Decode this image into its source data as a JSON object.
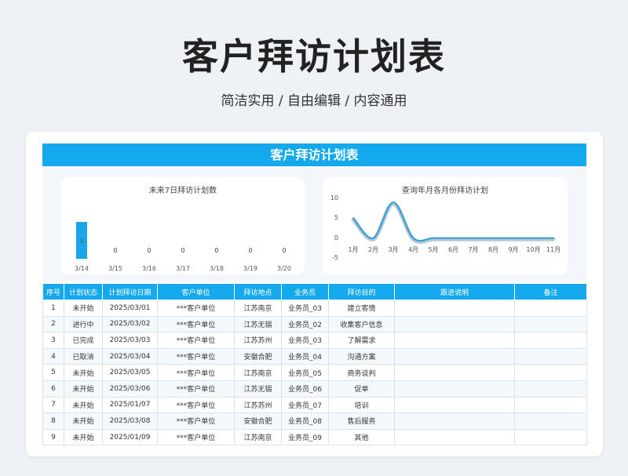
{
  "header": {
    "title": "客户拜访计划表",
    "subtitle": "简洁实用 / 自由编辑 / 内容通用"
  },
  "sheet": {
    "title": "客户拜访计划表"
  },
  "colors": {
    "accent": "#14a8ec",
    "line": "#2a9fd8",
    "shadow": "#b8c6d2"
  },
  "chart_data": [
    {
      "type": "bar",
      "title": "未来7日拜访计划数",
      "categories": [
        "3/14",
        "3/15",
        "3/16",
        "3/17",
        "3/18",
        "3/19",
        "3/20"
      ],
      "values": [
        1,
        0,
        0,
        0,
        0,
        0,
        0
      ],
      "value_labels": [
        "1",
        "0",
        "0",
        "0",
        "0",
        "0",
        "0"
      ]
    },
    {
      "type": "line",
      "title": "查询年月各月份拜访计划",
      "categories": [
        "1月",
        "2月",
        "3月",
        "4月",
        "5月",
        "6月",
        "7月",
        "8月",
        "9月",
        "10月",
        "11月"
      ],
      "values": [
        5,
        0,
        9,
        0,
        0,
        0,
        0,
        0,
        0,
        0,
        0
      ],
      "yticks": [
        "10",
        "5",
        "0",
        "-5"
      ],
      "ylim": [
        -5,
        10
      ],
      "smooth": true
    }
  ],
  "table": {
    "headers": [
      "序号",
      "计划状态",
      "计划拜访日期",
      "客户单位",
      "拜访地点",
      "业务员",
      "拜访目的",
      "跟进说明",
      "备注"
    ],
    "rows": [
      [
        "1",
        "未开始",
        "2025/03/01",
        "***客户单位",
        "江苏南京",
        "业务员_03",
        "建立客情",
        "",
        ""
      ],
      [
        "2",
        "进行中",
        "2025/03/02",
        "***客户单位",
        "江苏无锡",
        "业务员_02",
        "收集客户信息",
        "",
        ""
      ],
      [
        "3",
        "已完成",
        "2025/03/03",
        "***客户单位",
        "江苏苏州",
        "业务员_03",
        "了解需求",
        "",
        ""
      ],
      [
        "4",
        "已取消",
        "2025/03/04",
        "***客户单位",
        "安徽合肥",
        "业务员_04",
        "沟通方案",
        "",
        ""
      ],
      [
        "5",
        "未开始",
        "2025/03/05",
        "***客户单位",
        "江苏南京",
        "业务员_05",
        "商务谈判",
        "",
        ""
      ],
      [
        "6",
        "未开始",
        "2025/03/06",
        "***客户单位",
        "江苏无锡",
        "业务员_06",
        "促单",
        "",
        ""
      ],
      [
        "7",
        "未开始",
        "2025/01/07",
        "***客户单位",
        "江苏苏州",
        "业务员_07",
        "培训",
        "",
        ""
      ],
      [
        "8",
        "未开始",
        "2025/03/08",
        "***客户单位",
        "安徽合肥",
        "业务员_08",
        "售后服务",
        "",
        ""
      ],
      [
        "9",
        "未开始",
        "2025/01/09",
        "***客户单位",
        "江苏南京",
        "业务员_09",
        "其他",
        "",
        ""
      ]
    ]
  }
}
